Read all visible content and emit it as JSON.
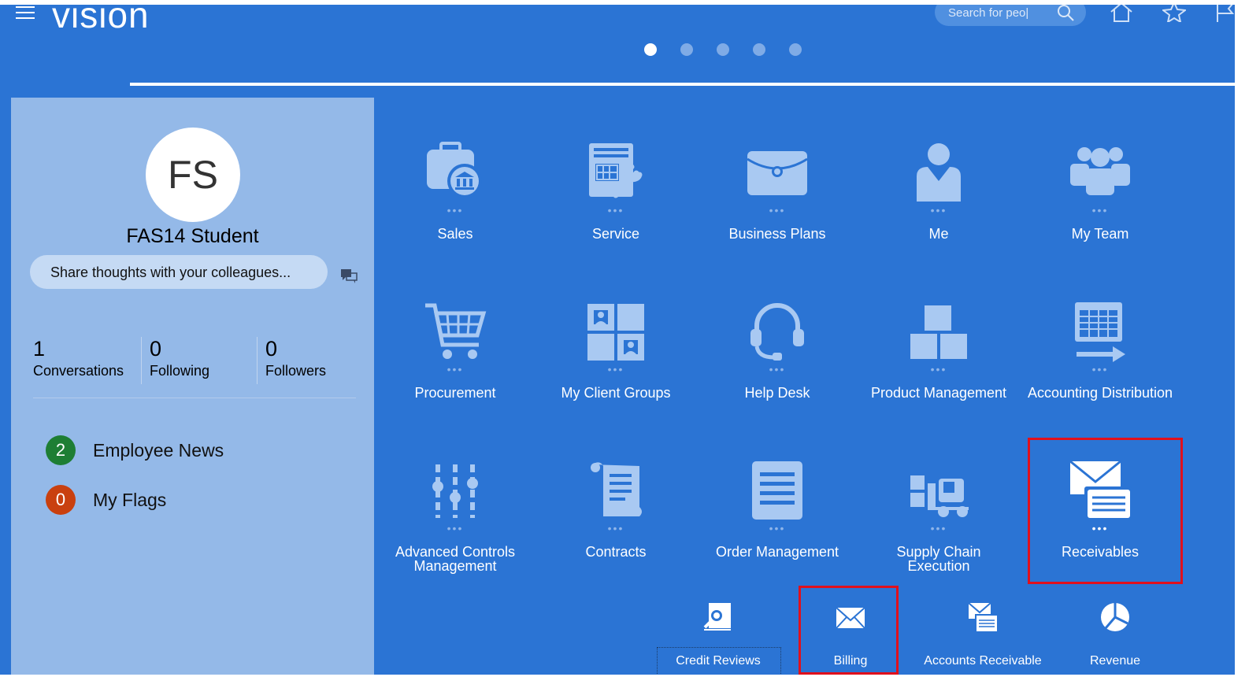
{
  "header": {
    "logo_text": "VISION",
    "search_placeholder": "Search for peo|",
    "carousel_dots": 5,
    "active_dot": 1
  },
  "profile": {
    "initials": "FS",
    "name": "FAS14 Student",
    "share_placeholder": "Share thoughts with your colleagues...",
    "stats": [
      {
        "value": "1",
        "label": "Conversations"
      },
      {
        "value": "0",
        "label": "Following"
      },
      {
        "value": "0",
        "label": "Followers"
      }
    ],
    "items": [
      {
        "count": "2",
        "label": "Employee News",
        "color": "#1e7e34"
      },
      {
        "count": "0",
        "label": "My Flags",
        "color": "#c9400f"
      }
    ]
  },
  "tiles": [
    {
      "label": "Sales",
      "icon": "sales-icon"
    },
    {
      "label": "Service",
      "icon": "service-icon"
    },
    {
      "label": "Business Plans",
      "icon": "briefcase-icon"
    },
    {
      "label": "Me",
      "icon": "person-icon"
    },
    {
      "label": "My Team",
      "icon": "team-icon"
    },
    {
      "label": "Procurement",
      "icon": "cart-icon"
    },
    {
      "label": "My Client Groups",
      "icon": "client-groups-icon"
    },
    {
      "label": "Help Desk",
      "icon": "headset-icon"
    },
    {
      "label": "Product Management",
      "icon": "boxes-icon"
    },
    {
      "label": "Accounting Distribution",
      "icon": "accounting-icon"
    },
    {
      "label": "Advanced Controls Management",
      "icon": "sliders-icon"
    },
    {
      "label": "Contracts",
      "icon": "scroll-icon"
    },
    {
      "label": "Order Management",
      "icon": "document-icon"
    },
    {
      "label": "Supply Chain Execution",
      "icon": "forklift-icon"
    },
    {
      "label": "Receivables",
      "icon": "receivables-icon"
    }
  ],
  "subtiles": [
    {
      "label": "Credit Reviews",
      "icon": "credit-review-icon"
    },
    {
      "label": "Billing",
      "icon": "envelope-icon"
    },
    {
      "label": "Accounts Receivable",
      "icon": "accounts-receivable-icon"
    },
    {
      "label": "Revenue",
      "icon": "pie-icon"
    }
  ],
  "colors": {
    "background": "#2b74d4",
    "panel": "#94b9e8",
    "icon": "#a9c9f2",
    "highlight": "#e0101c"
  }
}
